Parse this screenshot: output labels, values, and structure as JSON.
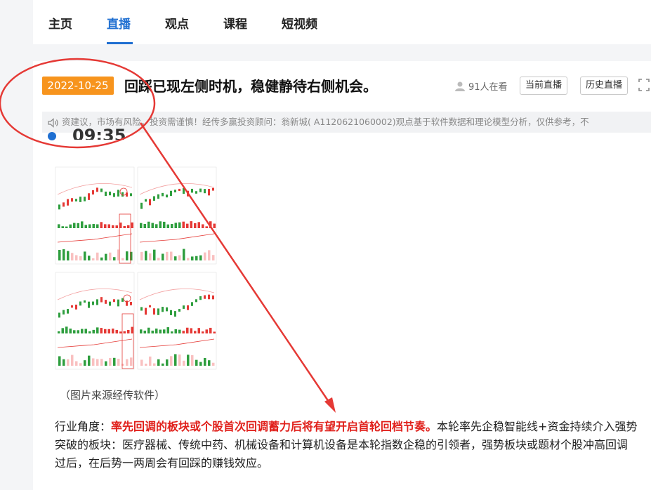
{
  "nav": {
    "tabs": [
      {
        "label": "主页"
      },
      {
        "label": "直播"
      },
      {
        "label": "观点"
      },
      {
        "label": "课程"
      },
      {
        "label": "短视频"
      }
    ],
    "active_index": 1
  },
  "live": {
    "date": "2022-10-25",
    "title": "回踩已现左侧时机，稳健静待右侧机会。",
    "viewers": "91人在看",
    "current_live_button": "当前直播",
    "history_live_button": "历史直播"
  },
  "notice": {
    "text": "资建议，市场有风险，投资需谨慎！经传多赢投资顾问：翁新城( A1120621060002)观点基于软件数据和理论模型分析，仅供参考，不"
  },
  "post": {
    "time": "09:35",
    "image_caption": "（图片来源经传软件）",
    "paragraph_prefix": "行业角度：",
    "paragraph_highlight": "率先回调的板块或个股首次回调蓄力后将有望开启首轮回档节奏。",
    "paragraph_rest": "本轮率先企稳智能线+资金持续介入强势突破的板块：医疗器械、传统中药、机械设备和计算机设备是本轮指数企稳的引领者，强势板块或题材个股冲高回调过后，在后势一两周会有回踩的赚钱效应。"
  },
  "colors": {
    "accent": "#1f6fd1",
    "date_badge": "#f7941d",
    "highlight": "#e0201b",
    "annotation": "#e53935"
  }
}
